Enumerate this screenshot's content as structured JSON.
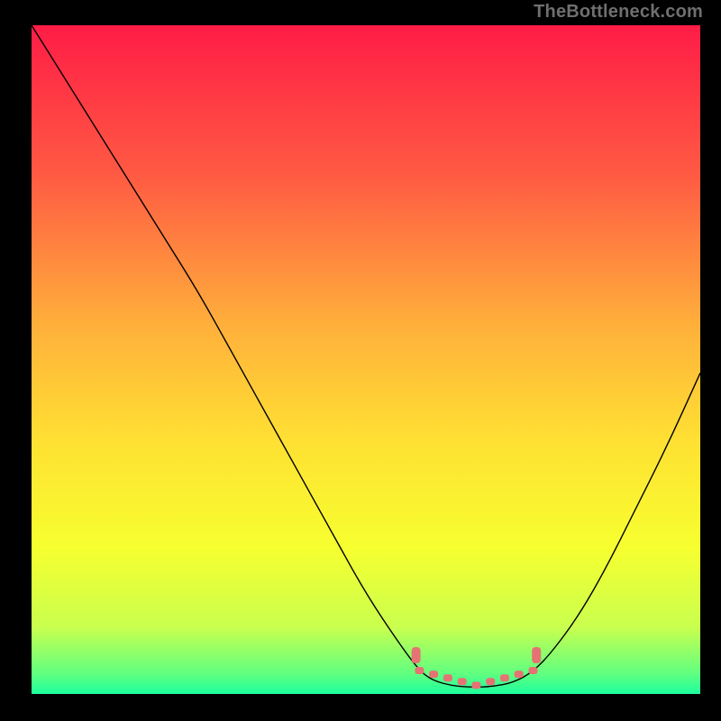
{
  "watermark": "TheBottleneck.com",
  "chart_data": {
    "type": "line",
    "title": "",
    "xlabel": "",
    "ylabel": "",
    "xlim": [
      0,
      100
    ],
    "ylim": [
      0,
      100
    ],
    "grid": false,
    "legend": false,
    "series": [
      {
        "name": "bottleneck-curve",
        "x": [
          0,
          5,
          10,
          15,
          20,
          25,
          30,
          35,
          40,
          45,
          50,
          55,
          58,
          60,
          63,
          66,
          69,
          72,
          75,
          78,
          82,
          86,
          90,
          95,
          100
        ],
        "y": [
          100,
          92,
          84,
          76,
          68,
          60,
          51,
          42,
          33,
          24,
          15,
          7.5,
          3.5,
          2,
          1.2,
          1,
          1.1,
          1.7,
          3.3,
          6.5,
          12,
          19,
          27,
          37,
          48
        ]
      }
    ],
    "annotations": [
      {
        "name": "optimal-band-marker",
        "x_range": [
          58,
          75
        ],
        "y": 1.3
      }
    ],
    "gradient_stops": [
      {
        "pct": 0,
        "color": "#ff1c46"
      },
      {
        "pct": 22,
        "color": "#ff5943"
      },
      {
        "pct": 45,
        "color": "#ffb03b"
      },
      {
        "pct": 62,
        "color": "#ffe033"
      },
      {
        "pct": 78,
        "color": "#f7ff2f"
      },
      {
        "pct": 90,
        "color": "#c9ff4e"
      },
      {
        "pct": 97,
        "color": "#60ff80"
      },
      {
        "pct": 100,
        "color": "#1cff9e"
      }
    ],
    "marker_color": "#e57373",
    "curve_color": "#000000"
  }
}
